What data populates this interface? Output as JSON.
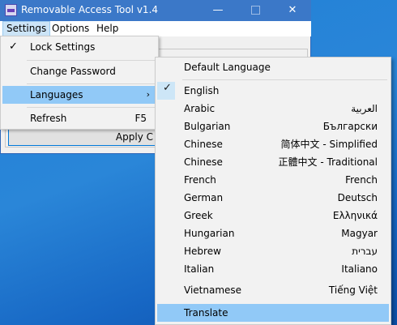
{
  "window": {
    "title": "Removable Access Tool v1.4",
    "min_glyph": "—",
    "close_glyph": "✕"
  },
  "menubar": {
    "settings": "Settings",
    "options": "Options",
    "help": "Help"
  },
  "apply_button": "Apply C",
  "settings_menu": {
    "lock_settings": "Lock Settings",
    "change_password": "Change Password",
    "languages": "Languages",
    "languages_arrow": "›",
    "refresh": "Refresh",
    "refresh_shortcut": "F5",
    "check_glyph": "✓"
  },
  "languages_menu": {
    "default_language": "Default Language",
    "items": [
      {
        "label": "English",
        "native": ""
      },
      {
        "label": "Arabic",
        "native": "العربية"
      },
      {
        "label": "Bulgarian",
        "native": "Български"
      },
      {
        "label": "Chinese",
        "native": "简体中文 - Simplified"
      },
      {
        "label": "Chinese",
        "native": "正體中文 - Traditional"
      },
      {
        "label": "French",
        "native": "French"
      },
      {
        "label": "German",
        "native": "Deutsch"
      },
      {
        "label": "Greek",
        "native": "Ελληνικά"
      },
      {
        "label": "Hungarian",
        "native": "Magyar"
      },
      {
        "label": "Hebrew",
        "native": "עברית"
      },
      {
        "label": "Italian",
        "native": "Italiano"
      },
      {
        "label": "Vietnamese",
        "native": "Tiếng Việt"
      }
    ],
    "translate": "Translate",
    "check_glyph": "✓"
  },
  "colors": {
    "highlight": "#91c9f7",
    "titlebar": "#3b78c8",
    "desktop": "#1f7fd6"
  }
}
